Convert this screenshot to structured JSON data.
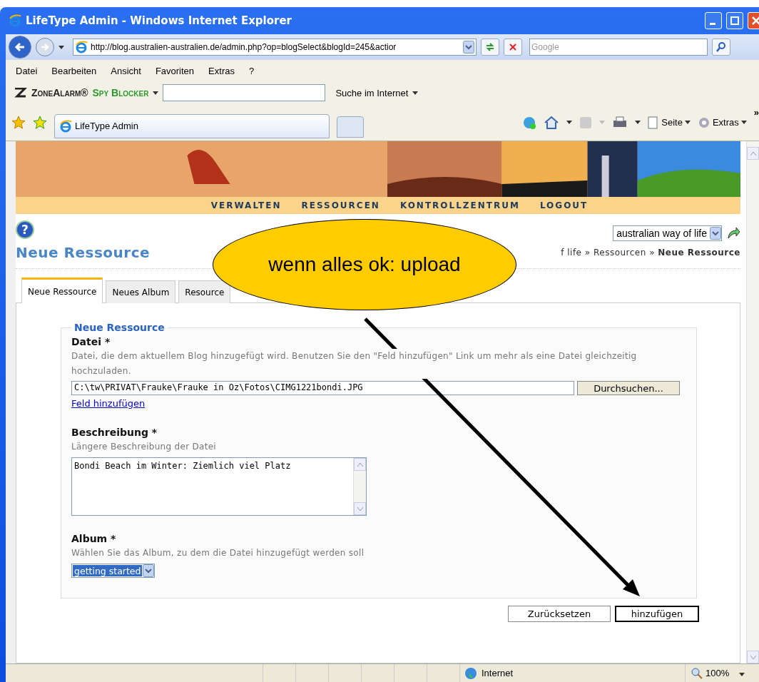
{
  "window": {
    "title": "LifeType Admin - Windows Internet Explorer"
  },
  "address_bar": {
    "url": "http://blog.australien-australien.de/admin.php?op=blogSelect&blogId=245&actior",
    "search_placeholder": "Google"
  },
  "menu": [
    "Datei",
    "Bearbeiten",
    "Ansicht",
    "Favoriten",
    "Extras",
    "?"
  ],
  "zonealarm": {
    "brand": "ZoneAlarm®",
    "product": "Spy Blocker",
    "search_label": "Suche im Internet"
  },
  "browser_tab": {
    "label": "LifeType Admin"
  },
  "command_bar": [
    "Seite",
    "Extras"
  ],
  "command_bar_overflow": "»",
  "help_button": "?",
  "page": {
    "nav": [
      "VERWALTEN",
      "RESSOURCEN",
      "KONTROLLZENTRUM",
      "LOGOUT"
    ],
    "blog_select": "australian way of life",
    "heading": "Neue Ressource",
    "breadcrumb": "f life » Ressourcen » **Neue Ressource**",
    "tabs": [
      {
        "label": "Neue Ressource",
        "selected": true
      },
      {
        "label": "Neues Album",
        "selected": false
      },
      {
        "label": "Resource",
        "selected": false
      }
    ],
    "form": {
      "legend": "Neue Ressource",
      "fields": [
        {
          "kind": "file",
          "label": "Datei *",
          "help": "Datei, die dem aktuellem Blog hinzugefügt wird. Benutzen Sie den \"Feld hinzufügen\" Link um mehr als eine Datei gleichzeitig hochzuladen.",
          "value": "C:\\tw\\PRIVAT\\Frauke\\Frauke in Oz\\Fotos\\CIMG1221bondi.JPG",
          "button": "Durchsuchen...",
          "link": "Feld hinzufügen"
        },
        {
          "kind": "textarea",
          "label": "Beschreibung *",
          "help": "Längere Beschreibung der Datei",
          "value": "Bondi Beach im Winter: Ziemlich viel Platz"
        },
        {
          "kind": "select",
          "label": "Album *",
          "help": "Wählen Sie das Album, zu dem die Datei hinzugefügt werden soll",
          "value": "getting started"
        }
      ]
    },
    "buttons": [
      {
        "kind": "reset",
        "label": "Zurücksetzen"
      },
      {
        "kind": "submit",
        "label": "hinzufügen"
      }
    ]
  },
  "annotation": {
    "text": "wenn alles ok: upload"
  },
  "status_bar": {
    "zone": "Internet",
    "zoom": "100%"
  }
}
